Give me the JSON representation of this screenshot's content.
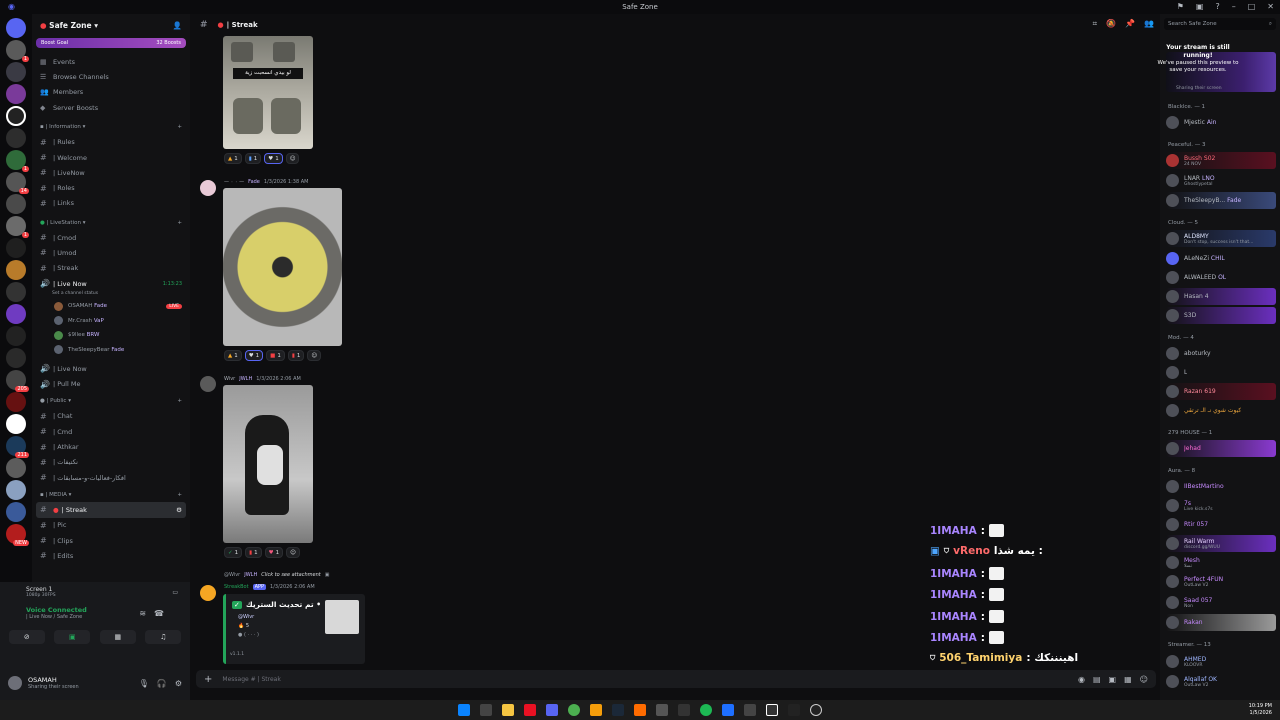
{
  "window": {
    "title": "Safe Zone"
  },
  "guild": {
    "name": "Safe Zone",
    "boost_label": "Boost Goal",
    "boost_count": "32 Boosts"
  },
  "nav": [
    {
      "label": "Events",
      "icon": "calendar-icon"
    },
    {
      "label": "Browse Channels",
      "icon": "browse-icon"
    },
    {
      "label": "Members",
      "icon": "members-icon"
    },
    {
      "label": "Server Boosts",
      "icon": "boost-icon"
    }
  ],
  "categories": {
    "information": "| Information",
    "livestation": "| LiveStation",
    "public": "| Public",
    "media": "| MEDIA"
  },
  "info_channels": [
    "| Rules",
    "| Welcome",
    "| LiveNow",
    "| Roles",
    "| Links"
  ],
  "live_channels": [
    "| Cmod",
    "| Umod",
    "| Streak"
  ],
  "voice_live": {
    "name": "| Live Now",
    "timer": "1:13:23",
    "status": "Set a channel status",
    "users": [
      {
        "name": "OSAMAH",
        "tag": "Fade",
        "live": "LIVE"
      },
      {
        "name": "Mr.Crash",
        "tag": "VaP",
        "live": ""
      },
      {
        "name": "$9llee",
        "tag": "BRW",
        "live": ""
      },
      {
        "name": "TheSleepyBear",
        "tag": "Fade",
        "live": ""
      }
    ]
  },
  "voice_others": [
    "| Live Now",
    "| Pull Me"
  ],
  "public_channels": [
    "| Chat",
    "| Cmd",
    "| Athkar",
    "| نكتيفات",
    "| افكار-فعاليات-و-مسابقات"
  ],
  "media_channels": [
    "| Streak",
    "| Pic",
    "| Clips",
    "| Edits"
  ],
  "panel": {
    "screen_title": "Screen 1",
    "screen_sub": "1080p 30FPS",
    "voice_connected": "Voice Connected",
    "voice_path": "| Live Now / Safe Zone",
    "user_name": "OSAMAH",
    "user_status": "Sharing their screen"
  },
  "channel": {
    "name": "| Streak",
    "composer_placeholder": "Message # | Streak"
  },
  "messages": {
    "img1_caption": "لو بيدي انسحبت زية",
    "reactions1": [
      "1",
      "1",
      "1"
    ],
    "meta2": {
      "time": "1/3/2026 1:38 AM",
      "tag": "Fade"
    },
    "reactions2": [
      "1",
      "1",
      "1",
      "1"
    ],
    "meta3": {
      "name": "Wivr",
      "tag": "JWLH",
      "time": "1/3/2026 2:06 AM"
    },
    "reactions3": [
      "1",
      "1",
      "1"
    ],
    "reply": {
      "name": "@Wivr",
      "tag": "JWLH",
      "text": "Click to see attachment"
    },
    "bot": {
      "name": "StreakBot",
      "tag": "APP",
      "time": "1/3/2026 2:06 AM",
      "embed_title": "تم تحديث الستريك •",
      "mention": "@Wivr",
      "version": "v1.1.1"
    }
  },
  "overlay_chat": [
    {
      "name": "1IMAHA",
      "text": ":",
      "color": "#a985ff"
    },
    {
      "name": "vReno",
      "text": "يمه شذا :",
      "color": "#ff6b6b"
    },
    {
      "name": "1IMAHA",
      "text": ":",
      "color": "#a985ff"
    },
    {
      "name": "1IMAHA",
      "text": ":",
      "color": "#a985ff"
    },
    {
      "name": "1IMAHA",
      "text": ":",
      "color": "#a985ff"
    },
    {
      "name": "1IMAHA",
      "text": ":",
      "color": "#a985ff"
    },
    {
      "name": "506_Tamimiya",
      "text": ": اهينننكك",
      "color": "#ffd36e"
    }
  ],
  "search": {
    "placeholder": "Search Safe Zone"
  },
  "stream_note": {
    "title": "Your stream is still running!",
    "body": "We've paused this preview to save your resources."
  },
  "members": {
    "top_sub": "Sharing their screen",
    "roles": [
      {
        "label": "Blacklce. — 1"
      },
      {
        "label": "Peaceful. — 3"
      },
      {
        "label": "Cloud. — 5"
      },
      {
        "label": "Mod. — 4"
      },
      {
        "label": "279 HOUSE — 1"
      },
      {
        "label": "Aura. — 8"
      },
      {
        "label": "Streamer. — 13"
      }
    ],
    "list": [
      {
        "name": "Mjestic",
        "tag": "Ain"
      },
      {
        "name": "Bussh",
        "tag": "S02",
        "sub": "24 NOV"
      },
      {
        "name": "LNAR",
        "tag": "LNO",
        "sub": "Ghostlypetal"
      },
      {
        "name": "TheSleepyB...",
        "tag": "Fade"
      },
      {
        "name": "ALD8MY",
        "sub": "Don't stop, success isn't that..."
      },
      {
        "name": "ALeNeZi",
        "tag": "CHIL"
      },
      {
        "name": "ALWALEED",
        "tag": "OL"
      },
      {
        "name": "Hasan",
        "tag": "4"
      },
      {
        "name": "S3D"
      },
      {
        "name": "aboturky"
      },
      {
        "name": "L"
      },
      {
        "name": "Razan",
        "tag": "619"
      },
      {
        "name": "كيوت شوي نـ الـ ترتقي"
      },
      {
        "name": "Jehad"
      },
      {
        "name": "IIBestMartino"
      },
      {
        "name": "7s",
        "sub": "Live kick.s7s"
      },
      {
        "name": "Rtir",
        "tag": "057"
      },
      {
        "name": "Rail",
        "tag": "Warm",
        "sub": "discord.gg/WUU"
      },
      {
        "name": "Mesh",
        "sub": "تسلا"
      },
      {
        "name": "Perfect",
        "tag": "4FUN",
        "sub": "OutLaw V2"
      },
      {
        "name": "Saad",
        "tag": "057",
        "sub": "Non"
      },
      {
        "name": "Rakan"
      },
      {
        "name": "AHMED",
        "sub": "KLOOVR"
      },
      {
        "name": "Alqallaf",
        "tag": "OK",
        "sub": "OutLaw V2"
      }
    ]
  },
  "clock": {
    "time": "10:19 PM",
    "date": "1/5/2026"
  },
  "colors": {
    "accent": "#5865f2",
    "green": "#23a55a",
    "red": "#f23f43",
    "overlay_name": "#a985ff"
  }
}
